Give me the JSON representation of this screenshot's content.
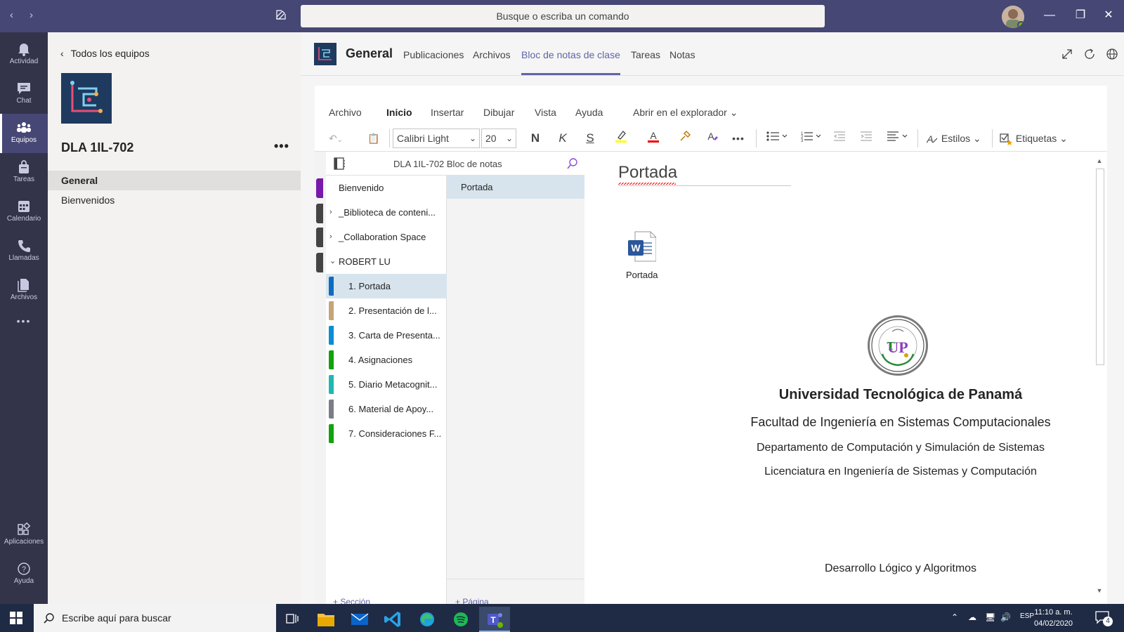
{
  "titlebar": {
    "search_placeholder": "Busque o escriba un comando",
    "nav_back": "‹",
    "nav_forward": "›",
    "minimize": "—",
    "restore": "❐",
    "close": "✕"
  },
  "rail": {
    "items": [
      {
        "label": "Actividad",
        "icon": "bell-icon"
      },
      {
        "label": "Chat",
        "icon": "chat-icon"
      },
      {
        "label": "Equipos",
        "icon": "teams-icon",
        "active": true
      },
      {
        "label": "Tareas",
        "icon": "bag-icon"
      },
      {
        "label": "Calendario",
        "icon": "calendar-icon"
      },
      {
        "label": "Llamadas",
        "icon": "phone-icon"
      },
      {
        "label": "Archivos",
        "icon": "files-icon"
      }
    ],
    "more": "•••",
    "apps_label": "Aplicaciones",
    "help_label": "Ayuda"
  },
  "teampane": {
    "back_label": "Todos los equipos",
    "team_name": "DLA 1IL-702",
    "more": "•••",
    "channels": [
      {
        "label": "General",
        "active": true
      },
      {
        "label": "Bienvenidos"
      }
    ]
  },
  "channel": {
    "title": "General",
    "tabs": [
      {
        "label": "Publicaciones"
      },
      {
        "label": "Archivos"
      },
      {
        "label": "Bloc de notas de clase",
        "active": true
      },
      {
        "label": "Tareas"
      },
      {
        "label": "Notas"
      }
    ]
  },
  "onenote": {
    "menus": [
      "Archivo",
      "Inicio",
      "Insertar",
      "Dibujar",
      "Vista",
      "Ayuda",
      "Abrir en el explorador"
    ],
    "font_name": "Calibri Light",
    "font_size": "20",
    "bold": "N",
    "italic": "K",
    "underline": "S",
    "styles_label": "Estilos",
    "tags_label": "Etiquetas",
    "more": "•••",
    "notebook_name": "DLA 1IL-702 Bloc de notas",
    "sections": [
      {
        "label": "Bienvenido",
        "indent": 0,
        "chevron": ""
      },
      {
        "label": "_Biblioteca de conteni...",
        "indent": 0,
        "chevron": "›"
      },
      {
        "label": "_Collaboration Space",
        "indent": 0,
        "chevron": "›"
      },
      {
        "label": "ROBERT LU",
        "indent": 0,
        "chevron": "⌄"
      },
      {
        "label": "1. Portada",
        "indent": 1,
        "color": "#0f6cbd",
        "active": true
      },
      {
        "label": "2. Presentación de l...",
        "indent": 1,
        "color": "#c4a57a"
      },
      {
        "label": "3. Carta de Presenta...",
        "indent": 1,
        "color": "#0b8dd6"
      },
      {
        "label": "4. Asignaciones",
        "indent": 1,
        "color": "#13a10e"
      },
      {
        "label": "5. Diario Metacognit...",
        "indent": 1,
        "color": "#1fb8b0"
      },
      {
        "label": "6. Material de Apoy...",
        "indent": 1,
        "color": "#7a7f86"
      },
      {
        "label": "7. Consideraciones F...",
        "indent": 1,
        "color": "#13a10e"
      }
    ],
    "add_section": "+ Sección",
    "pages": [
      {
        "label": "Portada",
        "active": true
      }
    ],
    "add_page": "+ Página"
  },
  "page": {
    "title": "Portada",
    "attachment_label": "Portada",
    "university": "Universidad Tecnológica de Panamá",
    "faculty": "Facultad de Ingeniería  en Sistemas  Computacionales",
    "department": "Departamento de Computación y Simulación de Sistemas",
    "degree": "Licenciatura en Ingeniería de Sistemas y Computación",
    "course": "Desarrollo Lógico y Algoritmos"
  },
  "taskbar": {
    "search_placeholder": "Escribe aquí para buscar",
    "time": "11:10 a. m.",
    "date": "04/02/2020",
    "lang": "ESP",
    "notifications": "4"
  },
  "colors": {
    "brand": "#464775",
    "accent": "#6264a7",
    "rail": "#33344a"
  }
}
